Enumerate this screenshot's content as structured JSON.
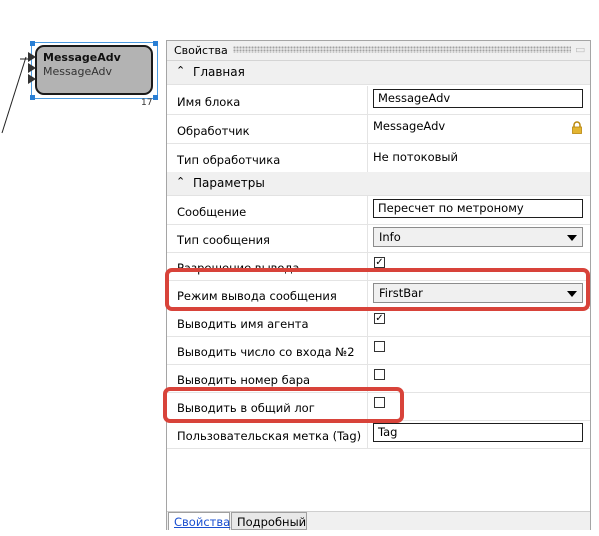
{
  "canvas_block": {
    "title": "MessageAdv",
    "subtitle": "MessageAdv",
    "number": "17"
  },
  "properties_panel": {
    "title": "Свойства",
    "categories": {
      "main": "Главная",
      "params": "Параметры"
    },
    "rows": {
      "block_name": {
        "label": "Имя блока",
        "value": "MessageAdv"
      },
      "handler": {
        "label": "Обработчик",
        "value": "MessageAdv",
        "icon": "lock-icon"
      },
      "handler_type": {
        "label": "Тип обработчика",
        "value": "Не потоковый"
      },
      "message": {
        "label": "Сообщение",
        "value": "Пересчет по метроному"
      },
      "message_type": {
        "label": "Тип сообщения",
        "value": "Info"
      },
      "output_enabled": {
        "label": "Разрешение вывода",
        "checked": true
      },
      "output_mode": {
        "label": "Режим вывода сообщения",
        "value": "FirstBar"
      },
      "agent_name": {
        "label": "Выводить имя агента",
        "checked": true
      },
      "input2_number": {
        "label": "Выводить число со входа №2",
        "checked": false
      },
      "bar_number": {
        "label": "Выводить номер бара",
        "checked": false
      },
      "common_log": {
        "label": "Выводить в общий лог",
        "checked": false
      },
      "user_tag": {
        "label": "Пользовательская метка (Tag)",
        "value": "Tag"
      }
    },
    "tabs": {
      "properties": "Свойства",
      "detailed": "Подробный"
    }
  },
  "colors": {
    "highlight": "#d8433a",
    "selection": "#2a7fd4",
    "block_fill": "#b3b3b3"
  }
}
